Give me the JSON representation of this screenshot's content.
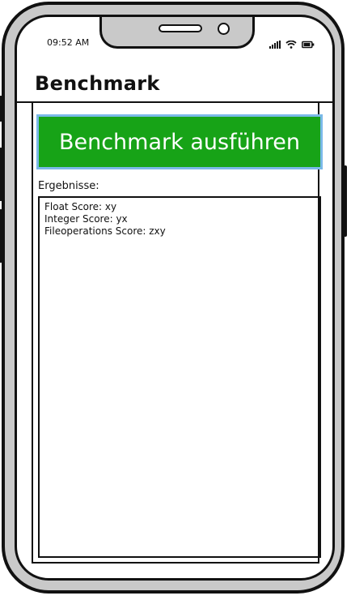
{
  "status_bar": {
    "time": "09:52 AM"
  },
  "header": {
    "title": "Benchmark"
  },
  "main": {
    "run_button_label": "Benchmark ausführen",
    "results_label": "Ergebnisse:",
    "results": [
      "Float Score: xy",
      "Integer Score: yx",
      "Fileoperations Score: zxy"
    ]
  },
  "icons": {
    "signal": "signal-icon",
    "wifi": "wifi-icon",
    "battery": "battery-icon"
  },
  "colors": {
    "button_fill": "#17a317",
    "button_border": "#7ab9e8",
    "frame": "#c9c9c9"
  }
}
